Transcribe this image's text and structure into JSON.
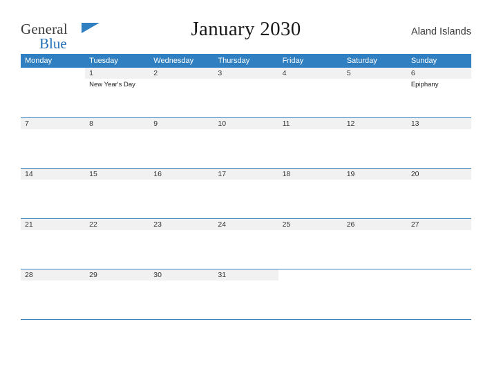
{
  "brand": {
    "name_part1": "General",
    "name_part2": "Blue",
    "flag_icon": "flag-icon"
  },
  "header": {
    "title": "January 2030",
    "region": "Aland Islands"
  },
  "calendar": {
    "weekday_headers": [
      "Monday",
      "Tuesday",
      "Wednesday",
      "Thursday",
      "Friday",
      "Saturday",
      "Sunday"
    ],
    "accent_color": "#2f7fc1",
    "daynum_bg": "#f1f1f1",
    "weeks": [
      [
        {
          "num": "",
          "event": ""
        },
        {
          "num": "1",
          "event": "New Year's Day"
        },
        {
          "num": "2",
          "event": ""
        },
        {
          "num": "3",
          "event": ""
        },
        {
          "num": "4",
          "event": ""
        },
        {
          "num": "5",
          "event": ""
        },
        {
          "num": "6",
          "event": "Epiphany"
        }
      ],
      [
        {
          "num": "7",
          "event": ""
        },
        {
          "num": "8",
          "event": ""
        },
        {
          "num": "9",
          "event": ""
        },
        {
          "num": "10",
          "event": ""
        },
        {
          "num": "11",
          "event": ""
        },
        {
          "num": "12",
          "event": ""
        },
        {
          "num": "13",
          "event": ""
        }
      ],
      [
        {
          "num": "14",
          "event": ""
        },
        {
          "num": "15",
          "event": ""
        },
        {
          "num": "16",
          "event": ""
        },
        {
          "num": "17",
          "event": ""
        },
        {
          "num": "18",
          "event": ""
        },
        {
          "num": "19",
          "event": ""
        },
        {
          "num": "20",
          "event": ""
        }
      ],
      [
        {
          "num": "21",
          "event": ""
        },
        {
          "num": "22",
          "event": ""
        },
        {
          "num": "23",
          "event": ""
        },
        {
          "num": "24",
          "event": ""
        },
        {
          "num": "25",
          "event": ""
        },
        {
          "num": "26",
          "event": ""
        },
        {
          "num": "27",
          "event": ""
        }
      ],
      [
        {
          "num": "28",
          "event": ""
        },
        {
          "num": "29",
          "event": ""
        },
        {
          "num": "30",
          "event": ""
        },
        {
          "num": "31",
          "event": ""
        },
        {
          "num": "",
          "event": ""
        },
        {
          "num": "",
          "event": ""
        },
        {
          "num": "",
          "event": ""
        }
      ]
    ]
  }
}
